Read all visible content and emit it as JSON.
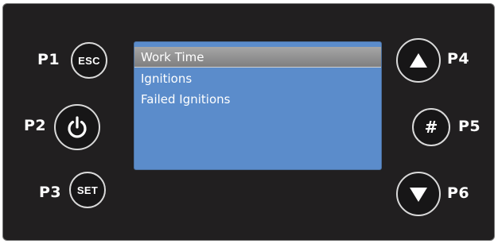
{
  "panel": {
    "labels": {
      "p1": "P1",
      "p2": "P2",
      "p3": "P3",
      "p4": "P4",
      "p5": "P5",
      "p6": "P6"
    },
    "buttons": {
      "esc": "ESC",
      "power_icon": "power-icon",
      "set": "SET",
      "up_icon": "triangle-up-icon",
      "hash": "#",
      "down_icon": "triangle-down-icon"
    }
  },
  "screen": {
    "menu": [
      {
        "label": "Work Time",
        "selected": true
      },
      {
        "label": "Ignitions",
        "selected": false
      },
      {
        "label": "Failed Ignitions",
        "selected": false
      }
    ]
  },
  "colors": {
    "panel_bg": "#211f20",
    "screen_bg": "#5b8ccb",
    "highlight": "#8f8f90",
    "button_border": "#d9d9d9"
  }
}
